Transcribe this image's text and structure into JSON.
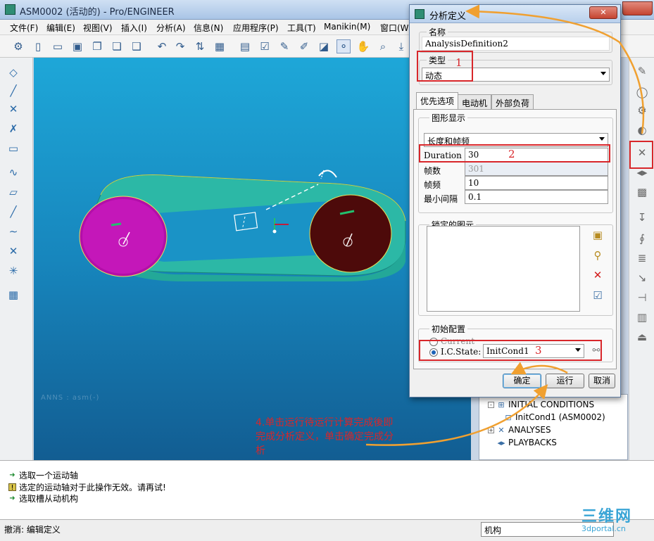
{
  "window": {
    "title": "ASM0002 (活动的) - Pro/ENGINEER",
    "close_label": ""
  },
  "menubar": {
    "items": [
      "文件(F)",
      "编辑(E)",
      "视图(V)",
      "插入(I)",
      "分析(A)",
      "信息(N)",
      "应用程序(P)",
      "工具(T)",
      "Manikin(M)",
      "窗口(W"
    ]
  },
  "viewport": {
    "watermark": "ANNS : asm(-)",
    "background_top": "#1ea7d8",
    "background_bottom": "#125d92"
  },
  "model_tree": {
    "rows": [
      {
        "label": "INITIAL CONDITIONS",
        "expander": "-"
      },
      {
        "label": "InitCond1 (ASM0002)",
        "expander": ""
      },
      {
        "label": "ANALYSES",
        "expander": "+"
      },
      {
        "label": "PLAYBACKS",
        "expander": ""
      }
    ]
  },
  "annotation_note": "4.单击运行待运行计算完成後即完成分析定义，单击确定完成分析",
  "messages": [
    {
      "text": "选取一个运动轴",
      "icon": "arrow-right-icon"
    },
    {
      "text": "选定的运动轴对于此操作无效。请再试!",
      "icon": "warning-icon"
    },
    {
      "text": "选取槽从动机构",
      "icon": "arrow-right-icon"
    }
  ],
  "status": {
    "text": "撤消: 编辑定义",
    "filter": "机构",
    "logo": "三维网",
    "logo_sub": "3dportal.cn"
  },
  "dialog": {
    "title": "分析定义",
    "name_group": {
      "label": "名称",
      "value": "AnalysisDefinition2"
    },
    "type_group": {
      "label": "类型",
      "value": "动态"
    },
    "tabs": [
      "优先选项",
      "电动机",
      "外部负荷"
    ],
    "graphics_group": {
      "label": "图形显示",
      "mode": "长度和帧频",
      "fields": [
        {
          "label": "Duration",
          "value": "30"
        },
        {
          "label": "帧数",
          "value": "301"
        },
        {
          "label": "帧频",
          "value": "10"
        },
        {
          "label": "最小间隔",
          "value": "0.1"
        }
      ]
    },
    "locked_group": {
      "label": "锁定的图元"
    },
    "init_group": {
      "label": "初始配置",
      "options": [
        {
          "label": "Current",
          "checked": false
        },
        {
          "label": "I.C.State:",
          "checked": true
        }
      ],
      "state_value": "InitCond1"
    },
    "buttons": {
      "ok": "确定",
      "run": "运行",
      "cancel": "取消"
    }
  },
  "annotations": {
    "num1": "1",
    "num2": "2",
    "num3": "3",
    "color": "#d8262a",
    "arrow_color": "#f0a030"
  }
}
